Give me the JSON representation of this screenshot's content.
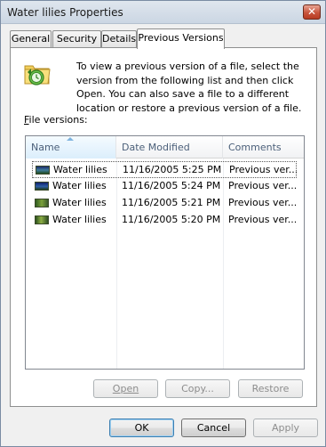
{
  "window": {
    "title": "Water lilies Properties",
    "close_label": "✕"
  },
  "tabs": [
    {
      "label": "General",
      "active": false
    },
    {
      "label": "Security",
      "active": false
    },
    {
      "label": "Details",
      "active": false
    },
    {
      "label": "Previous Versions",
      "active": true
    }
  ],
  "panel": {
    "icon": "restore-previous-versions-icon",
    "info_text": "To view a previous version of a file, select the version from the following list and then click Open.  You can also save a file to a different location or restore a previous version of a file.",
    "file_versions_label_first": "F",
    "file_versions_label_rest": "ile versions:",
    "list": {
      "columns": [
        "Name",
        "Date Modified",
        "Comments"
      ],
      "rows": [
        {
          "name": "Water lilies",
          "date": "11/16/2005 5:25 PM",
          "comment": "Previous ver...",
          "selected": true
        },
        {
          "name": "Water lilies",
          "date": "11/16/2005 5:24 PM",
          "comment": "Previous ver...",
          "selected": false
        },
        {
          "name": "Water lilies",
          "date": "11/16/2005 5:21 PM",
          "comment": "Previous ver...",
          "selected": false
        },
        {
          "name": "Water lilies",
          "date": "11/16/2005 5:20 PM",
          "comment": "Previous ver...",
          "selected": false
        }
      ]
    },
    "buttons": {
      "open": "Open",
      "copy": "Copy...",
      "restore": "Restore"
    }
  },
  "footer": {
    "ok": "OK",
    "cancel": "Cancel",
    "apply": "Apply"
  },
  "colors": {
    "accent": "#3c7fb1",
    "disabled_text": "#8d8d8d"
  }
}
